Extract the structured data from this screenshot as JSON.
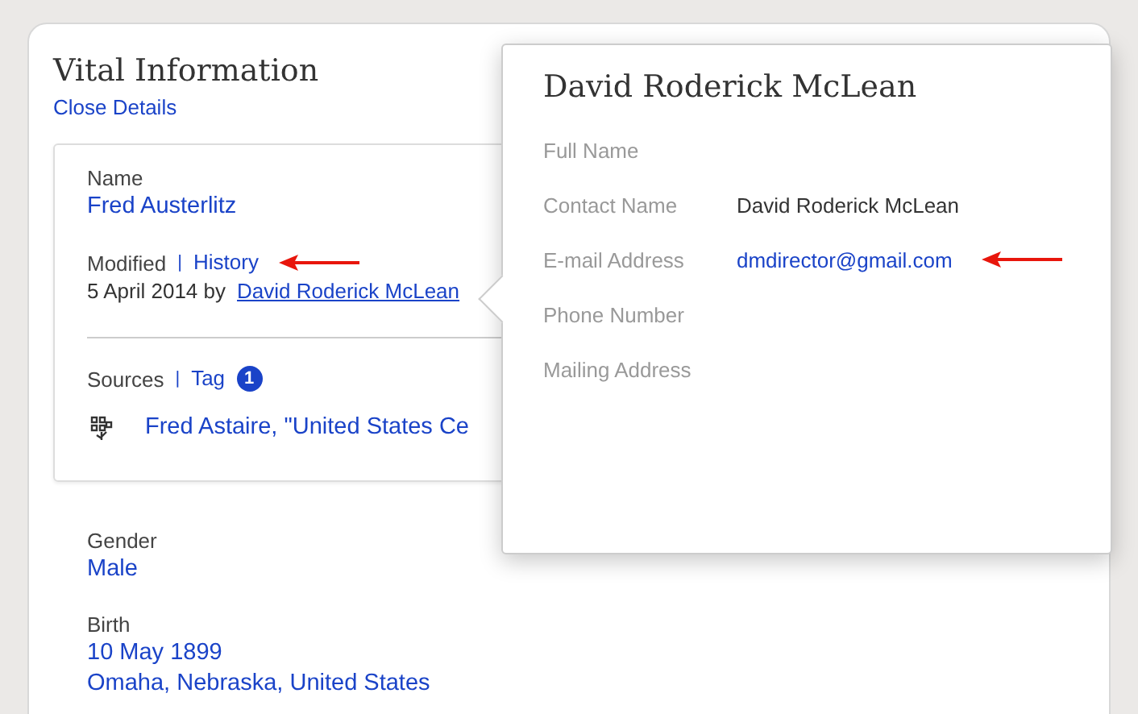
{
  "section": {
    "title": "Vital Information",
    "close_link": "Close Details"
  },
  "record": {
    "name_label": "Name",
    "name": "Fred Austerlitz",
    "modified_label": "Modified",
    "separator": "|",
    "history_link": "History",
    "history_annotated": true,
    "modified_date": "5 April 2014 by",
    "modified_by": "David Roderick McLean",
    "sources_label": "Sources",
    "tag_link": "Tag",
    "tag_count": "1",
    "source": "Fred Astaire, \"United States Ce"
  },
  "facts": [
    {
      "label": "Gender",
      "values": [
        "Male"
      ]
    },
    {
      "label": "Birth",
      "values": [
        "10 May 1899",
        "Omaha, Nebraska, United States"
      ]
    }
  ],
  "popup": {
    "title": "David Roderick McLean",
    "fields": [
      {
        "label": "Full Name",
        "annotated": false
      },
      {
        "label": "Contact Name",
        "value": "David Roderick McLean",
        "kind": "text",
        "annotated": false
      },
      {
        "label": "E-mail Address",
        "value": "dmdirector@gmail.com",
        "kind": "link",
        "annotated": true
      },
      {
        "label": "Phone Number",
        "annotated": false
      },
      {
        "label": "Mailing Address",
        "annotated": false
      }
    ]
  }
}
